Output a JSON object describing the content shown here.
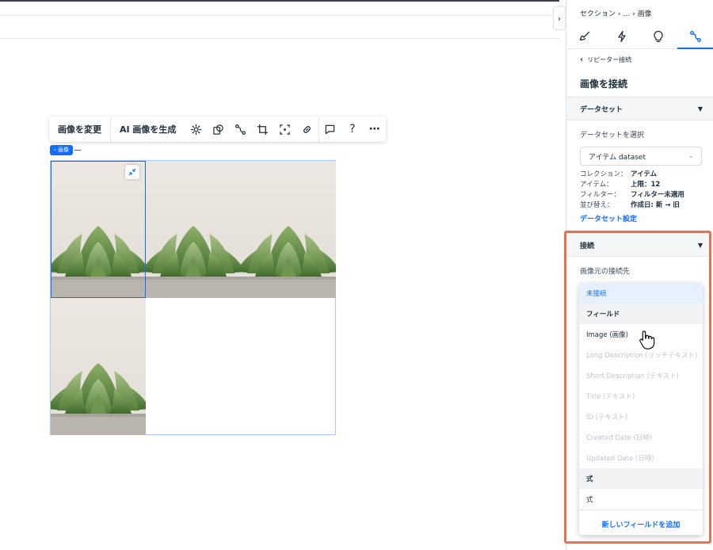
{
  "colors": {
    "accent": "#116dff",
    "highlight": "#e8724f",
    "selected_bg": "#e7f0ff"
  },
  "toolbar": {
    "change_image": "画像を変更",
    "ai_generate": "AI 画像を生成",
    "icons": [
      "settings-icon",
      "animation-icon",
      "connect-data-icon",
      "crop-icon",
      "focal-point-icon",
      "link-icon",
      "comment-icon",
      "help-icon",
      "more-icon"
    ],
    "help_glyph": "?",
    "more_glyph": "⋯"
  },
  "element_chip": "‹ 画像",
  "panel": {
    "breadcrumb": "セクション › … › 画像",
    "tabs": [
      "design-tab",
      "interactions-tab",
      "ideas-tab",
      "connect-data-tab"
    ],
    "back_label": "リピーター接続",
    "title": "画像を接続",
    "dataset_section": {
      "header": "データセット",
      "select_label": "データセットを選択",
      "select_value": "アイテム dataset",
      "info": [
        {
          "key": "コレクション：",
          "value": "アイテム"
        },
        {
          "key": "アイテム：",
          "value": "上限：12"
        },
        {
          "key": "フィルター：",
          "value": "フィルター未適用"
        },
        {
          "key": "並び替え：",
          "value": "作成日: 新 → 旧"
        }
      ],
      "settings_link": "データセット設定"
    },
    "connect_section": {
      "header": "接続",
      "label": "画像元の接続先"
    }
  },
  "dropdown": {
    "items": [
      {
        "label": "未接続",
        "state": "selected"
      },
      {
        "label": "フィールド",
        "state": "group"
      },
      {
        "label": "Image (画像)",
        "state": "normal"
      },
      {
        "label": "Long Description (リッチテキスト)",
        "state": "disabled"
      },
      {
        "label": "Short Description (テキスト)",
        "state": "disabled"
      },
      {
        "label": "Title (テキスト)",
        "state": "disabled"
      },
      {
        "label": "ID (テキスト)",
        "state": "disabled"
      },
      {
        "label": "Created Date (日時)",
        "state": "disabled"
      },
      {
        "label": "Updated Date (日時)",
        "state": "disabled"
      },
      {
        "label": "式",
        "state": "group"
      },
      {
        "label": "式",
        "state": "normal"
      }
    ],
    "footer": "新しいフィールドを追加"
  }
}
